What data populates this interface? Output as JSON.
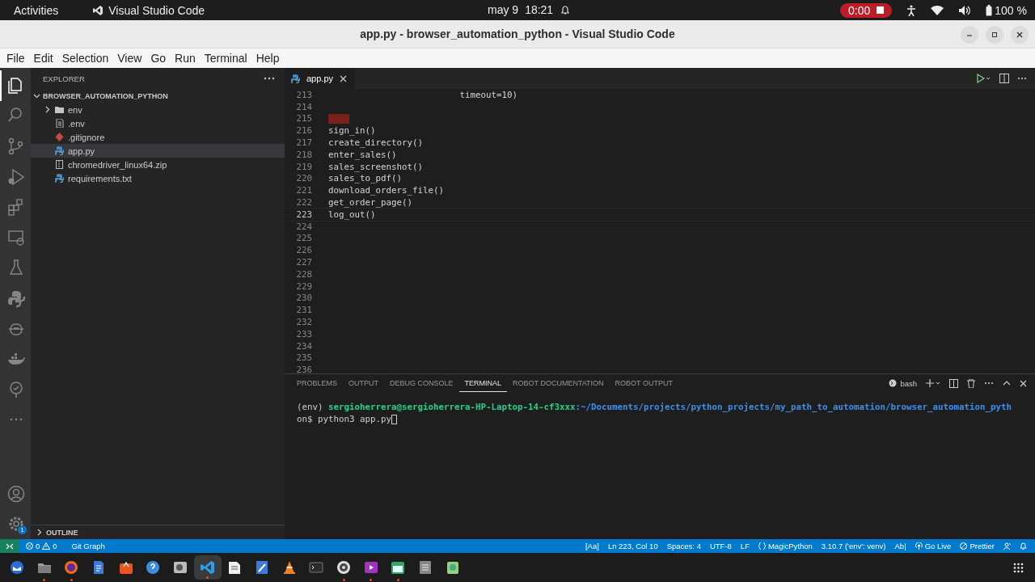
{
  "topbar": {
    "activities": "Activities",
    "app_name": "Visual Studio Code",
    "date": "may 9",
    "time": "18:21",
    "recording": "0:00",
    "battery": "100 %"
  },
  "window": {
    "title": "app.py - browser_automation_python - Visual Studio Code"
  },
  "menu": [
    "File",
    "Edit",
    "Selection",
    "View",
    "Go",
    "Run",
    "Terminal",
    "Help"
  ],
  "activity_bar": {
    "items": [
      {
        "kind": "files",
        "selected": true
      },
      {
        "kind": "search",
        "selected": false
      },
      {
        "kind": "branch",
        "selected": false
      },
      {
        "kind": "debug",
        "selected": false
      },
      {
        "kind": "blocks",
        "selected": false
      },
      {
        "kind": "monitor",
        "selected": false
      },
      {
        "kind": "flask",
        "selected": false
      },
      {
        "kind": "python",
        "selected": false
      },
      {
        "kind": "robot",
        "selected": false
      },
      {
        "kind": "whale",
        "selected": false
      },
      {
        "kind": "tree",
        "selected": false
      },
      {
        "kind": "dots",
        "selected": false
      }
    ],
    "bottom": [
      {
        "kind": "account",
        "selected": false
      },
      {
        "kind": "gear",
        "selected": false
      }
    ],
    "settings_badge": "1"
  },
  "sidebar": {
    "title": "EXPLORER",
    "folder": {
      "label": "BROWSER_AUTOMATION_PYTHON",
      "expanded": true,
      "children": [
        {
          "label": "env",
          "kind": "folder",
          "expanded": false,
          "selected": false
        },
        {
          "label": ".env",
          "kind": "settings",
          "selected": false
        },
        {
          "label": ".gitignore",
          "kind": "git",
          "selected": false
        },
        {
          "label": "app.py",
          "kind": "python",
          "selected": true
        },
        {
          "label": "chromedriver_linux64.zip",
          "kind": "zip",
          "selected": false
        },
        {
          "label": "requirements.txt",
          "kind": "python",
          "selected": false
        }
      ]
    },
    "outline": {
      "label": "OUTLINE",
      "expanded": false
    }
  },
  "editor": {
    "tabs": [
      {
        "label": "app.py",
        "selected": true
      }
    ],
    "lines": [
      {
        "number": "213",
        "code": "                         timeout=10)",
        "current": false,
        "whitespace_marker": false
      },
      {
        "number": "214",
        "current": false,
        "whitespace_marker": false
      },
      {
        "number": "215",
        "current": false,
        "whitespace_marker": true
      },
      {
        "number": "216",
        "code": "sign_in()",
        "current": false,
        "whitespace_marker": false
      },
      {
        "number": "217",
        "code": "create_directory()",
        "current": false,
        "whitespace_marker": false
      },
      {
        "number": "218",
        "code": "enter_sales()",
        "current": false,
        "whitespace_marker": false
      },
      {
        "number": "219",
        "code": "sales_screenshot()",
        "current": false,
        "whitespace_marker": false
      },
      {
        "number": "220",
        "code": "sales_to_pdf()",
        "current": false,
        "whitespace_marker": false
      },
      {
        "number": "221",
        "code": "download_orders_file()",
        "current": false,
        "whitespace_marker": false
      },
      {
        "number": "222",
        "code": "get_order_page()",
        "current": false,
        "whitespace_marker": false
      },
      {
        "number": "223",
        "code": "log_out()",
        "current": true,
        "whitespace_marker": false
      },
      {
        "number": "224",
        "current": false,
        "whitespace_marker": false
      },
      {
        "number": "225",
        "current": false,
        "whitespace_marker": false
      },
      {
        "number": "226",
        "current": false,
        "whitespace_marker": false
      },
      {
        "number": "227",
        "current": false,
        "whitespace_marker": false
      },
      {
        "number": "228",
        "current": false,
        "whitespace_marker": false
      },
      {
        "number": "229",
        "current": false,
        "whitespace_marker": false
      },
      {
        "number": "230",
        "current": false,
        "whitespace_marker": false
      },
      {
        "number": "231",
        "current": false,
        "whitespace_marker": false
      },
      {
        "number": "232",
        "current": false,
        "whitespace_marker": false
      },
      {
        "number": "233",
        "current": false,
        "whitespace_marker": false
      },
      {
        "number": "234",
        "current": false,
        "whitespace_marker": false
      },
      {
        "number": "235",
        "current": false,
        "whitespace_marker": false
      },
      {
        "number": "236",
        "current": false,
        "whitespace_marker": false
      }
    ]
  },
  "panel": {
    "tabs": [
      {
        "label": "PROBLEMS",
        "selected": false
      },
      {
        "label": "OUTPUT",
        "selected": false
      },
      {
        "label": "DEBUG CONSOLE",
        "selected": false
      },
      {
        "label": "TERMINAL",
        "selected": true
      },
      {
        "label": "ROBOT DOCUMENTATION",
        "selected": false
      },
      {
        "label": "ROBOT OUTPUT",
        "selected": false
      }
    ],
    "shell": "bash",
    "terminal": {
      "env": "(env) ",
      "user": "sergioherrera@sergioherrera-HP-Laptop-14-cf3xxx",
      "path": ":~/Documents/projects/python_projects/my_path_to_automation/browser_automation_pyth",
      "command": "on$ python3 app.py"
    }
  },
  "status_bar": {
    "errors": "0",
    "warnings": "0",
    "git": "Git Graph",
    "right": [
      {
        "text": "[Aa]"
      },
      {
        "text": "Ln 223, Col 10"
      },
      {
        "text": "Spaces: 4"
      },
      {
        "text": "UTF-8"
      },
      {
        "text": "LF"
      },
      {
        "text": "MagicPython",
        "kind": "language"
      },
      {
        "text": "3.10.7 ('env': venv)"
      },
      {
        "text": "Ab|"
      },
      {
        "text": "Go Live",
        "kind": "live"
      },
      {
        "text": "Prettier",
        "kind": "formatter"
      },
      {
        "kind": "feedback"
      },
      {
        "kind": "notifications"
      }
    ]
  },
  "dock": {
    "apps": [
      {
        "kind": "bird",
        "running": false,
        "selected": false
      },
      {
        "kind": "folder",
        "running": true,
        "selected": false
      },
      {
        "kind": "globe",
        "running": true,
        "selected": false
      },
      {
        "kind": "document",
        "running": false,
        "selected": false
      },
      {
        "kind": "bag",
        "running": false,
        "selected": false
      },
      {
        "kind": "help",
        "running": false,
        "selected": false
      },
      {
        "kind": "camera",
        "running": false,
        "selected": false
      },
      {
        "kind": "code",
        "running": true,
        "selected": true
      },
      {
        "kind": "page",
        "running": false,
        "selected": false
      },
      {
        "kind": "pencil",
        "running": false,
        "selected": false
      },
      {
        "kind": "cone",
        "running": false,
        "selected": false
      },
      {
        "kind": "terminal",
        "running": false,
        "selected": false
      },
      {
        "kind": "disc",
        "running": true,
        "selected": false
      },
      {
        "kind": "play",
        "running": true,
        "selected": false
      },
      {
        "kind": "calendar",
        "running": true,
        "selected": false
      },
      {
        "kind": "list",
        "running": false,
        "selected": false
      },
      {
        "kind": "archive",
        "running": false,
        "selected": false
      }
    ]
  }
}
